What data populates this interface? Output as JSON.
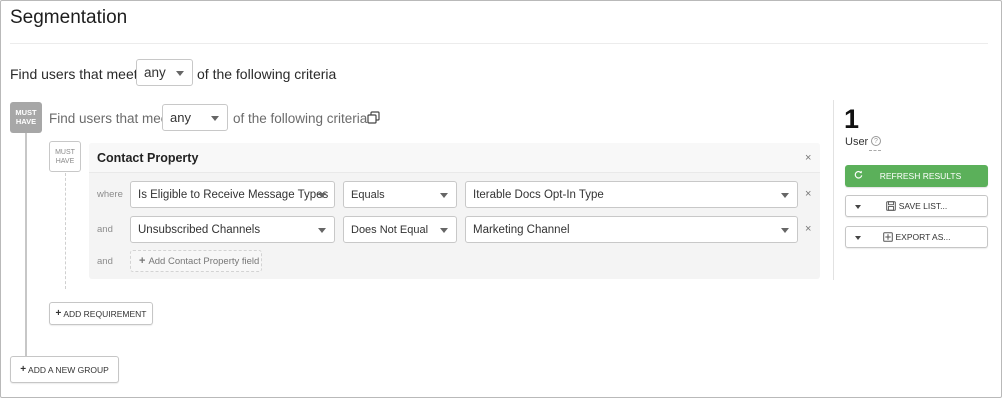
{
  "page": {
    "title": "Segmentation"
  },
  "top_criteria": {
    "prefix": "Find users that meet",
    "match_value": "any",
    "suffix": "of the following criteria"
  },
  "group": {
    "badge_line1": "MUST",
    "badge_line2": "HAVE",
    "prefix": "Find users that meet",
    "match_value": "any",
    "suffix": "of the following criteria",
    "requirement": {
      "badge_line1": "MUST",
      "badge_line2": "HAVE",
      "title": "Contact Property",
      "rows": [
        {
          "connector": "where",
          "field": "Is Eligible to Receive Message Types",
          "operator": "Equals",
          "value": "Iterable Docs Opt-In Type"
        },
        {
          "connector": "and",
          "field": "Unsubscribed Channels",
          "operator": "Does Not Equal",
          "value": "Marketing Channel"
        }
      ],
      "add_connector": "and",
      "add_field_label": "Add Contact Property field"
    },
    "add_requirement_label": "ADD REQUIREMENT"
  },
  "add_group_label": "ADD A NEW GROUP",
  "results": {
    "count": "1",
    "count_label": "User",
    "refresh_label": "REFRESH RESULTS",
    "save_label": "SAVE LIST...",
    "export_label": "EXPORT AS..."
  },
  "icons": {
    "remove": "×",
    "plus": "+",
    "help": "?"
  },
  "colors": {
    "accent_green": "#5bb05a",
    "badge_gray": "#a7a7a7"
  }
}
